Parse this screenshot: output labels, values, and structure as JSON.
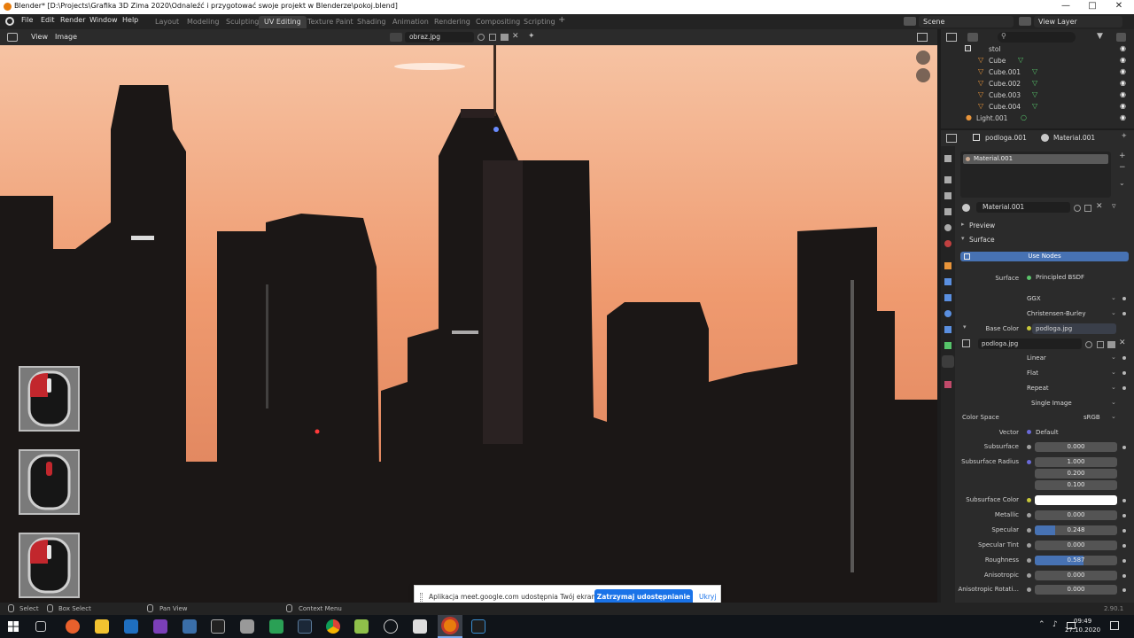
{
  "window": {
    "title": "Blender* [D:\\Projects\\Grafika 3D Zima 2020\\Odnaleźć i przygotować swoje projekt w Blenderze\\pokoj.blend]"
  },
  "menu": [
    "File",
    "Edit",
    "Render",
    "Window",
    "Help"
  ],
  "workspaces": [
    {
      "label": "Layout",
      "active": false
    },
    {
      "label": "Modeling",
      "active": false
    },
    {
      "label": "Sculpting",
      "active": false
    },
    {
      "label": "UV Editing",
      "active": true
    },
    {
      "label": "Texture Paint",
      "active": false
    },
    {
      "label": "Shading",
      "active": false
    },
    {
      "label": "Animation",
      "active": false
    },
    {
      "label": "Rendering",
      "active": false
    },
    {
      "label": "Compositing",
      "active": false
    },
    {
      "label": "Scripting",
      "active": false
    }
  ],
  "scene": "Scene",
  "view_layer": "View Layer",
  "image_editor": {
    "menu": [
      "View",
      "Image"
    ],
    "image_name": "obraz.jpg"
  },
  "outliner": {
    "rows": [
      {
        "label": "stol",
        "icon": "collection"
      },
      {
        "label": "Cube",
        "icon": "mesh"
      },
      {
        "label": "Cube.001",
        "icon": "mesh"
      },
      {
        "label": "Cube.002",
        "icon": "mesh"
      },
      {
        "label": "Cube.003",
        "icon": "mesh"
      },
      {
        "label": "Cube.004",
        "icon": "mesh"
      },
      {
        "label": "Light.001",
        "icon": "light"
      }
    ]
  },
  "properties": {
    "object": "podloga.001",
    "material_tab": "Material.001",
    "slot": "Material.001",
    "material_name": "Material.001",
    "panels": {
      "preview": "Preview",
      "surface": "Surface"
    },
    "use_nodes": "Use Nodes",
    "surface_label": "Surface",
    "surface_value": "Principled BSDF",
    "distribution": "GGX",
    "subsurface_method": "Christensen-Burley",
    "base_color_label": "Base Color",
    "base_color_value": "podloga.jpg",
    "image_name": "podloga.jpg",
    "interpolation": "Linear",
    "projection": "Flat",
    "extension": "Repeat",
    "source": "Single Image",
    "color_space_label": "Color Space",
    "color_space_value": "sRGB",
    "vector_label": "Vector",
    "vector_value": "Default",
    "fields": [
      {
        "label": "Subsurface",
        "value": "0.000",
        "fill": 0
      },
      {
        "label": "Subsurface Radius",
        "value": "1.000",
        "fill": 0
      },
      {
        "label": "",
        "value": "0.200",
        "fill": 0
      },
      {
        "label": "",
        "value": "0.100",
        "fill": 0
      },
      {
        "label": "Subsurface Color",
        "value": "",
        "fill": 0
      },
      {
        "label": "Metallic",
        "value": "0.000",
        "fill": 0
      },
      {
        "label": "Specular",
        "value": "0.248",
        "fill": 0.248
      },
      {
        "label": "Specular Tint",
        "value": "0.000",
        "fill": 0
      },
      {
        "label": "Roughness",
        "value": "0.587",
        "fill": 0.587
      },
      {
        "label": "Anisotropic",
        "value": "0.000",
        "fill": 0
      },
      {
        "label": "Anisotropic Rotati...",
        "value": "0.000",
        "fill": 0
      }
    ]
  },
  "status": {
    "select": "Select",
    "box_select": "Box Select",
    "pan_view": "Pan View",
    "context_menu": "Context Menu",
    "version": "2.90.1"
  },
  "share_toast": {
    "message": "Aplikacja meet.google.com udostępnia Twój ekran.",
    "stop": "Zatrzymaj udostępnianie",
    "hide": "Ukryj"
  },
  "clock": {
    "time": "09:49",
    "date": "27.10.2020"
  },
  "colors": {
    "accent": "#4772b3",
    "sky": "#f0a077",
    "toast_button": "#1a73e8"
  }
}
